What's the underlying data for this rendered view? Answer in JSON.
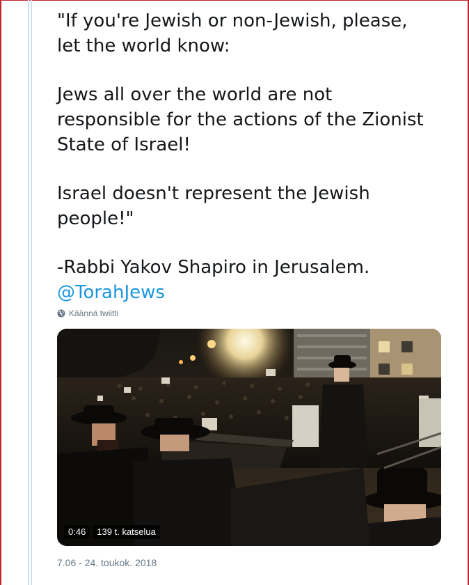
{
  "tweet": {
    "lines": [
      "\"If you're Jewish or non-Jewish, please,",
      "let the world know:",
      "Jews all over the world are not",
      "responsible for the actions of the Zionist",
      "State of Israel!",
      "Israel doesn't represent the Jewish",
      "people!\"",
      "-Rabbi Yakov Shapiro in Jerusalem."
    ],
    "mention": "@TorahJews"
  },
  "translate": {
    "icon": "globe-icon",
    "label": "Käännä twiitti"
  },
  "video": {
    "duration": "0:46",
    "views": "139 t. katselua"
  },
  "timestamp": "7.06 - 24. toukok. 2018",
  "colors": {
    "text": "#14171a",
    "link": "#1b95e0",
    "muted": "#657786",
    "frame": "#c1232c"
  }
}
